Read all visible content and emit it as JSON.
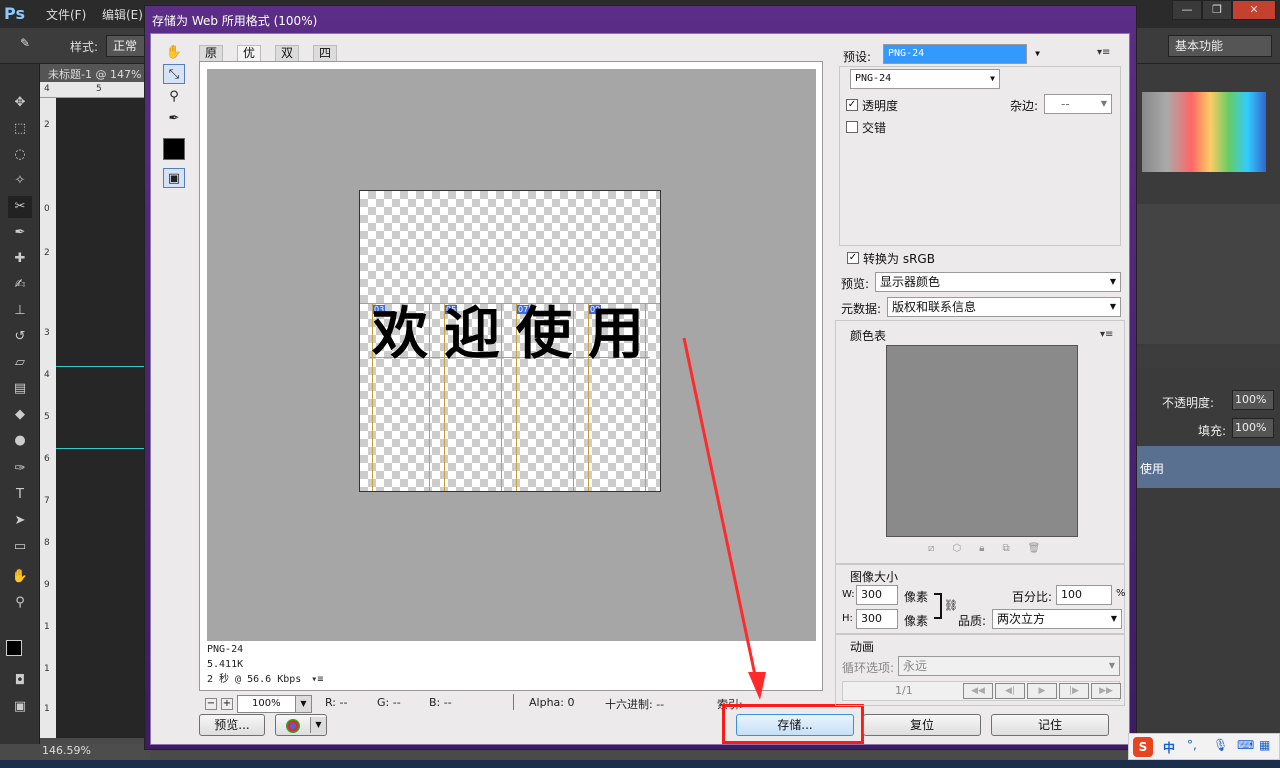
{
  "ps": {
    "logo": "Ps",
    "menu": [
      "文件(F)",
      "编辑(E)"
    ],
    "style_label": "样式:",
    "style_value": "正常",
    "workspace": "基本功能",
    "doc_tab": "未标题-1 @ 147%",
    "zoom_status": "146.59%",
    "ruler_x": [
      "4",
      "5"
    ],
    "ruler_y": [
      "2",
      "0",
      "2",
      "3",
      "4",
      "5",
      "6",
      "7",
      "8",
      "9",
      "1",
      "1",
      "1",
      "1"
    ],
    "opacity_label": "不透明度:",
    "opacity_value": "100%",
    "fill_label": "填充:",
    "fill_value": "100%",
    "layer_name": "使用",
    "win_buttons": [
      "—",
      "❐",
      "✕"
    ]
  },
  "dialog": {
    "title": "存储为 Web 所用格式 (100%)",
    "tabs": [
      "原稿",
      "优化",
      "双联",
      "四联"
    ],
    "active_tab": "优化",
    "image_text": [
      "欢",
      "迎",
      "使",
      "用"
    ],
    "slice_tags": [
      "03",
      "05",
      "07",
      "09"
    ],
    "info": {
      "format": "PNG-24",
      "size": "5.411K",
      "speed": "2 秒 @ 56.6 Kbps"
    },
    "zoom": "100%",
    "readouts": {
      "r": "R: --",
      "g": "G: --",
      "b": "B: --",
      "alpha": "Alpha: 0",
      "hex": "十六进制: --",
      "index": "索引: --"
    },
    "buttons": {
      "preview": "预览...",
      "save": "存储...",
      "reset": "复位",
      "remember": "记住"
    },
    "settings": {
      "preset_label": "预设:",
      "preset_value": "PNG-24",
      "format_value": "PNG-24",
      "transparency": "透明度",
      "transparency_checked": true,
      "matte_label": "杂边:",
      "matte_value": "--",
      "interlaced": "交错",
      "interlaced_checked": false,
      "convert_srgb": "转换为 sRGB",
      "convert_srgb_checked": true,
      "preview_label": "预览:",
      "preview_value": "显示器颜色",
      "metadata_label": "元数据:",
      "metadata_value": "版权和联系信息"
    },
    "color_table": {
      "title": "颜色表"
    },
    "image_size": {
      "title": "图像大小",
      "w_label": "W:",
      "w_value": "300",
      "h_label": "H:",
      "h_value": "300",
      "unit": "像素",
      "percent_label": "百分比:",
      "percent_value": "100",
      "percent_unit": "%",
      "quality_label": "品质:",
      "quality_value": "两次立方"
    },
    "animation": {
      "title": "动画",
      "loop_label": "循环选项:",
      "loop_value": "永远",
      "frame": "1/1"
    }
  },
  "ime": {
    "logo": "S",
    "lang": "中"
  },
  "colors": {
    "highlight": "#ff1a1a",
    "dialog_title": "#5b2d86"
  }
}
